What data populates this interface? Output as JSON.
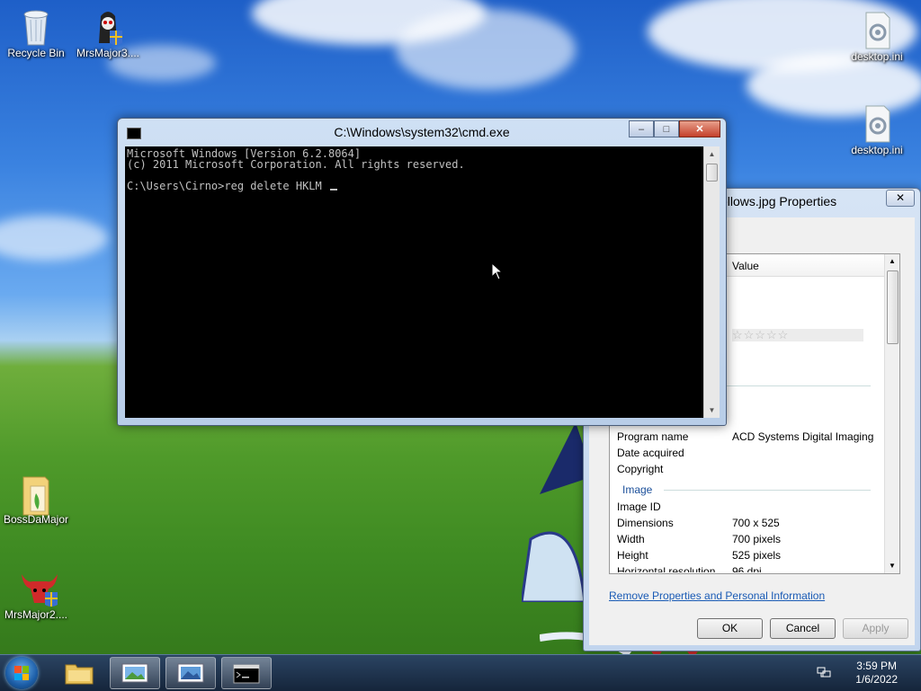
{
  "desktop": {
    "icons": [
      {
        "label": "Recycle Bin",
        "icon": "recycle-bin-icon"
      },
      {
        "label": "MrsMajor3....",
        "icon": "mrsmajor-skull-icon"
      },
      {
        "label": "desktop.ini",
        "icon": "settings-file-icon"
      },
      {
        "label": "desktop.ini",
        "icon": "settings-file-icon"
      },
      {
        "label": "BossDaMajor",
        "icon": "folder-icon"
      },
      {
        "label": "MrsMajor2....",
        "icon": "mrsmajor-bull-icon"
      }
    ]
  },
  "cmd": {
    "title": "C:\\Windows\\system32\\cmd.exe",
    "line1": "Microsoft Windows [Version 6.2.8064]",
    "line2": "(c) 2011 Microsoft Corporation. All rights reserved.",
    "line3": "",
    "prompt": "C:\\Users\\Cirno>reg delete HKLM ",
    "buttons": {
      "minimize": "–",
      "maximize": "□",
      "close": "✕"
    }
  },
  "properties": {
    "title": "ellows.jpg Properties",
    "close": "✕",
    "column_value": "Value",
    "rating_stars": "☆☆☆☆☆",
    "rows": [
      {
        "key": "Program name",
        "value": "ACD Systems Digital Imaging"
      },
      {
        "key": "Date acquired",
        "value": ""
      },
      {
        "key": "Copyright",
        "value": ""
      }
    ],
    "section_image": "Image",
    "image_rows": [
      {
        "key": "Image ID",
        "value": ""
      },
      {
        "key": "Dimensions",
        "value": "700 x 525"
      },
      {
        "key": "Width",
        "value": "700 pixels"
      },
      {
        "key": "Height",
        "value": "525 pixels"
      },
      {
        "key": "Horizontal resolution",
        "value": "96 dpi"
      }
    ],
    "link": "Remove Properties and Personal Information",
    "ok": "OK",
    "cancel": "Cancel",
    "apply": "Apply"
  },
  "taskbar": {
    "time": "3:59 PM",
    "date": "1/6/2022",
    "items": [
      "explorer-icon",
      "picture-viewer-icon",
      "picture-viewer-icon",
      "cmd-icon"
    ]
  }
}
